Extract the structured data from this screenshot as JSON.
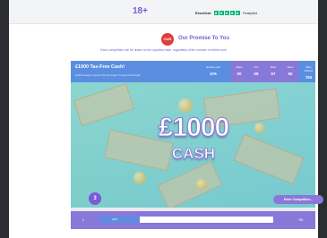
{
  "topbar": {
    "age_badge": "18+",
    "trustpilot": {
      "rating_label": "Excellent",
      "stars": [
        "★",
        "★",
        "★",
        "★",
        "★"
      ],
      "brand": "Trustpilot"
    }
  },
  "promise": {
    "icon_text": "OUR",
    "title": "Our Promise To You",
    "subtitle": "Each competition will be drawn on the specified date, regardless of the number of entries sold"
  },
  "competition": {
    "title": "£1000 Tax-Free Cash!",
    "description": "£1000 Ready to Spend! Winner Drawn Tonight at Midnight!",
    "entries_left_label": "Entries Left",
    "entries_left_value": "576",
    "countdown": [
      {
        "label": "Days",
        "value": "00"
      },
      {
        "label": "Hrs",
        "value": "08"
      },
      {
        "label": "Mins",
        "value": "57"
      },
      {
        "label": "Secs",
        "value": "55"
      }
    ],
    "max_entries_label": "Max Entries",
    "max_entries_value": "750",
    "hero_amount": "£1000",
    "hero_cash": "CASH",
    "ticket_count": "3",
    "enter_button": "Enter Competition..."
  },
  "progress": {
    "min": "0",
    "max": "750",
    "percent_label": "23%",
    "fraction": 0.23
  },
  "colors": {
    "accent_purple": "#7a5bd6",
    "header_blue": "#5b8ee0",
    "trust_green": "#00b67a"
  }
}
